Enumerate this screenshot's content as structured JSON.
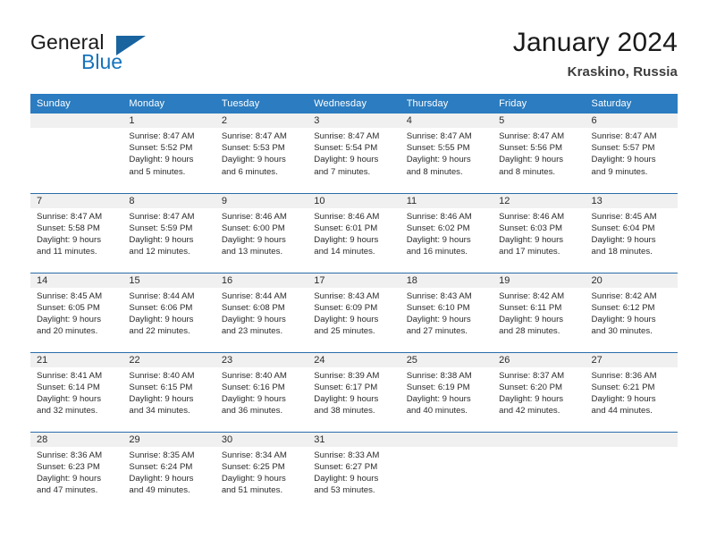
{
  "brand": {
    "name_part1": "General",
    "name_part2": "Blue",
    "accent_color": "#1573bd",
    "triangle_color": "#19649f"
  },
  "header": {
    "title": "January 2024",
    "subtitle": "Kraskino, Russia",
    "header_bg": "#2b7cc0",
    "separator_color": "#2b6cab",
    "daynum_bg": "#f0f0f0"
  },
  "weekdays": [
    "Sunday",
    "Monday",
    "Tuesday",
    "Wednesday",
    "Thursday",
    "Friday",
    "Saturday"
  ],
  "weeks": [
    [
      {
        "day": "",
        "l1": "",
        "l2": "",
        "l3": "",
        "l4": ""
      },
      {
        "day": "1",
        "l1": "Sunrise: 8:47 AM",
        "l2": "Sunset: 5:52 PM",
        "l3": "Daylight: 9 hours",
        "l4": "and 5 minutes."
      },
      {
        "day": "2",
        "l1": "Sunrise: 8:47 AM",
        "l2": "Sunset: 5:53 PM",
        "l3": "Daylight: 9 hours",
        "l4": "and 6 minutes."
      },
      {
        "day": "3",
        "l1": "Sunrise: 8:47 AM",
        "l2": "Sunset: 5:54 PM",
        "l3": "Daylight: 9 hours",
        "l4": "and 7 minutes."
      },
      {
        "day": "4",
        "l1": "Sunrise: 8:47 AM",
        "l2": "Sunset: 5:55 PM",
        "l3": "Daylight: 9 hours",
        "l4": "and 8 minutes."
      },
      {
        "day": "5",
        "l1": "Sunrise: 8:47 AM",
        "l2": "Sunset: 5:56 PM",
        "l3": "Daylight: 9 hours",
        "l4": "and 8 minutes."
      },
      {
        "day": "6",
        "l1": "Sunrise: 8:47 AM",
        "l2": "Sunset: 5:57 PM",
        "l3": "Daylight: 9 hours",
        "l4": "and 9 minutes."
      }
    ],
    [
      {
        "day": "7",
        "l1": "Sunrise: 8:47 AM",
        "l2": "Sunset: 5:58 PM",
        "l3": "Daylight: 9 hours",
        "l4": "and 11 minutes."
      },
      {
        "day": "8",
        "l1": "Sunrise: 8:47 AM",
        "l2": "Sunset: 5:59 PM",
        "l3": "Daylight: 9 hours",
        "l4": "and 12 minutes."
      },
      {
        "day": "9",
        "l1": "Sunrise: 8:46 AM",
        "l2": "Sunset: 6:00 PM",
        "l3": "Daylight: 9 hours",
        "l4": "and 13 minutes."
      },
      {
        "day": "10",
        "l1": "Sunrise: 8:46 AM",
        "l2": "Sunset: 6:01 PM",
        "l3": "Daylight: 9 hours",
        "l4": "and 14 minutes."
      },
      {
        "day": "11",
        "l1": "Sunrise: 8:46 AM",
        "l2": "Sunset: 6:02 PM",
        "l3": "Daylight: 9 hours",
        "l4": "and 16 minutes."
      },
      {
        "day": "12",
        "l1": "Sunrise: 8:46 AM",
        "l2": "Sunset: 6:03 PM",
        "l3": "Daylight: 9 hours",
        "l4": "and 17 minutes."
      },
      {
        "day": "13",
        "l1": "Sunrise: 8:45 AM",
        "l2": "Sunset: 6:04 PM",
        "l3": "Daylight: 9 hours",
        "l4": "and 18 minutes."
      }
    ],
    [
      {
        "day": "14",
        "l1": "Sunrise: 8:45 AM",
        "l2": "Sunset: 6:05 PM",
        "l3": "Daylight: 9 hours",
        "l4": "and 20 minutes."
      },
      {
        "day": "15",
        "l1": "Sunrise: 8:44 AM",
        "l2": "Sunset: 6:06 PM",
        "l3": "Daylight: 9 hours",
        "l4": "and 22 minutes."
      },
      {
        "day": "16",
        "l1": "Sunrise: 8:44 AM",
        "l2": "Sunset: 6:08 PM",
        "l3": "Daylight: 9 hours",
        "l4": "and 23 minutes."
      },
      {
        "day": "17",
        "l1": "Sunrise: 8:43 AM",
        "l2": "Sunset: 6:09 PM",
        "l3": "Daylight: 9 hours",
        "l4": "and 25 minutes."
      },
      {
        "day": "18",
        "l1": "Sunrise: 8:43 AM",
        "l2": "Sunset: 6:10 PM",
        "l3": "Daylight: 9 hours",
        "l4": "and 27 minutes."
      },
      {
        "day": "19",
        "l1": "Sunrise: 8:42 AM",
        "l2": "Sunset: 6:11 PM",
        "l3": "Daylight: 9 hours",
        "l4": "and 28 minutes."
      },
      {
        "day": "20",
        "l1": "Sunrise: 8:42 AM",
        "l2": "Sunset: 6:12 PM",
        "l3": "Daylight: 9 hours",
        "l4": "and 30 minutes."
      }
    ],
    [
      {
        "day": "21",
        "l1": "Sunrise: 8:41 AM",
        "l2": "Sunset: 6:14 PM",
        "l3": "Daylight: 9 hours",
        "l4": "and 32 minutes."
      },
      {
        "day": "22",
        "l1": "Sunrise: 8:40 AM",
        "l2": "Sunset: 6:15 PM",
        "l3": "Daylight: 9 hours",
        "l4": "and 34 minutes."
      },
      {
        "day": "23",
        "l1": "Sunrise: 8:40 AM",
        "l2": "Sunset: 6:16 PM",
        "l3": "Daylight: 9 hours",
        "l4": "and 36 minutes."
      },
      {
        "day": "24",
        "l1": "Sunrise: 8:39 AM",
        "l2": "Sunset: 6:17 PM",
        "l3": "Daylight: 9 hours",
        "l4": "and 38 minutes."
      },
      {
        "day": "25",
        "l1": "Sunrise: 8:38 AM",
        "l2": "Sunset: 6:19 PM",
        "l3": "Daylight: 9 hours",
        "l4": "and 40 minutes."
      },
      {
        "day": "26",
        "l1": "Sunrise: 8:37 AM",
        "l2": "Sunset: 6:20 PM",
        "l3": "Daylight: 9 hours",
        "l4": "and 42 minutes."
      },
      {
        "day": "27",
        "l1": "Sunrise: 8:36 AM",
        "l2": "Sunset: 6:21 PM",
        "l3": "Daylight: 9 hours",
        "l4": "and 44 minutes."
      }
    ],
    [
      {
        "day": "28",
        "l1": "Sunrise: 8:36 AM",
        "l2": "Sunset: 6:23 PM",
        "l3": "Daylight: 9 hours",
        "l4": "and 47 minutes."
      },
      {
        "day": "29",
        "l1": "Sunrise: 8:35 AM",
        "l2": "Sunset: 6:24 PM",
        "l3": "Daylight: 9 hours",
        "l4": "and 49 minutes."
      },
      {
        "day": "30",
        "l1": "Sunrise: 8:34 AM",
        "l2": "Sunset: 6:25 PM",
        "l3": "Daylight: 9 hours",
        "l4": "and 51 minutes."
      },
      {
        "day": "31",
        "l1": "Sunrise: 8:33 AM",
        "l2": "Sunset: 6:27 PM",
        "l3": "Daylight: 9 hours",
        "l4": "and 53 minutes."
      },
      {
        "day": "",
        "l1": "",
        "l2": "",
        "l3": "",
        "l4": ""
      },
      {
        "day": "",
        "l1": "",
        "l2": "",
        "l3": "",
        "l4": ""
      },
      {
        "day": "",
        "l1": "",
        "l2": "",
        "l3": "",
        "l4": ""
      }
    ]
  ]
}
